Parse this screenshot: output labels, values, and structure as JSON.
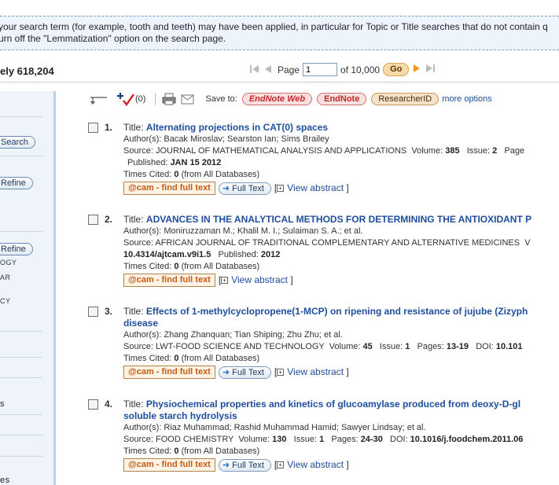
{
  "notice": {
    "line1": "your search term (for example, tooth and teeth) may have been applied, in particular for Topic or Title searches that do not contain q",
    "line2": "urn off the \"Lemmatization\" option on the search page."
  },
  "results": {
    "count_text": "ely 618,204"
  },
  "pager": {
    "page_label": "Page",
    "page_value": "1",
    "of_text": "of 10,000",
    "go_label": "Go"
  },
  "sidebar": {
    "search_button": "Search",
    "refine_button_1": "Refine",
    "refine_button_2": "Refine",
    "text1": "OGY",
    "text2": "AR",
    "text3": "CY",
    "text4": "s",
    "text5": "es"
  },
  "toolbar": {
    "marked_count": "(0)",
    "save_to": "Save to:",
    "endnote_web": "EndNote Web",
    "endnote": "EndNote",
    "researcherid": "ResearcherID",
    "more_options": "more options"
  },
  "labels": {
    "title": "Title:",
    "authors": "Author(s):",
    "source": "Source:",
    "times_cited": "Times Cited:",
    "from_all": "(from All Databases)",
    "cam_button": "@cam - find full text",
    "full_text": "Full Text",
    "view_abstract": "View abstract"
  },
  "records": [
    {
      "num": "1.",
      "title1": "Alternating projections in CAT(0) spaces",
      "title2": "",
      "authors": "Bacak Miroslav; Searston Ian; Sims Brailey",
      "source_name": "JOURNAL OF MATHEMATICAL ANALYSIS AND APPLICATIONS",
      "source_rest": "Volume: ",
      "volume": "385",
      "issue_label": "Issue: ",
      "issue": "2",
      "tail": "Page",
      "line4_label": "Published: ",
      "line4_value": "JAN 15 2012",
      "line4_pre": "",
      "times_cited": "0",
      "has_fulltext": true
    },
    {
      "num": "2.",
      "title1": "ADVANCES IN THE ANALYTICAL METHODS FOR DETERMINING THE ANTIOXIDANT P",
      "title2": "",
      "authors": "Moniruzzaman M.; Khalil M. I.; Sulaiman S. A.; et al.",
      "source_name": "AFRICAN JOURNAL OF TRADITIONAL COMPLEMENTARY AND ALTERNATIVE MEDICINES",
      "source_rest": "V",
      "volume": "",
      "issue_label": "",
      "issue": "",
      "tail": "",
      "line4_pre": "10.4314/ajtcam.v9i1.5",
      "line4_label": "Published: ",
      "line4_value": "2012",
      "times_cited": "0",
      "has_fulltext": false
    },
    {
      "num": "3.",
      "title1": "Effects of 1-methylcyclopropene(1-MCP) on ripening and resistance of jujube (Zizyph",
      "title2": "disease",
      "authors": "Zhang Zhanquan; Tian Shiping; Zhu Zhu; et al.",
      "source_name": "LWT-FOOD SCIENCE AND TECHNOLOGY",
      "source_rest": "Volume: ",
      "volume": "45",
      "issue_label": "Issue: ",
      "issue": "1",
      "tail_label": "Pages: ",
      "tail": "13-19",
      "doi_label": "DOI: ",
      "doi": "10.101",
      "times_cited": "0",
      "has_fulltext": true
    },
    {
      "num": "4.",
      "title1": "Physiochemical properties and kinetics of glucoamylase produced from deoxy-D-gl",
      "title2": "soluble starch hydrolysis",
      "authors": "Riaz Muhammad; Rashid Muhammad Hamid; Sawyer Lindsay; et al.",
      "source_name": "FOOD CHEMISTRY",
      "source_rest": "Volume: ",
      "volume": "130",
      "issue_label": "Issue: ",
      "issue": "1",
      "tail_label": "Pages: ",
      "tail": "24-30",
      "doi_label": "DOI: ",
      "doi": "10.1016/j.foodchem.2011.06",
      "times_cited": "0",
      "has_fulltext": true
    }
  ]
}
